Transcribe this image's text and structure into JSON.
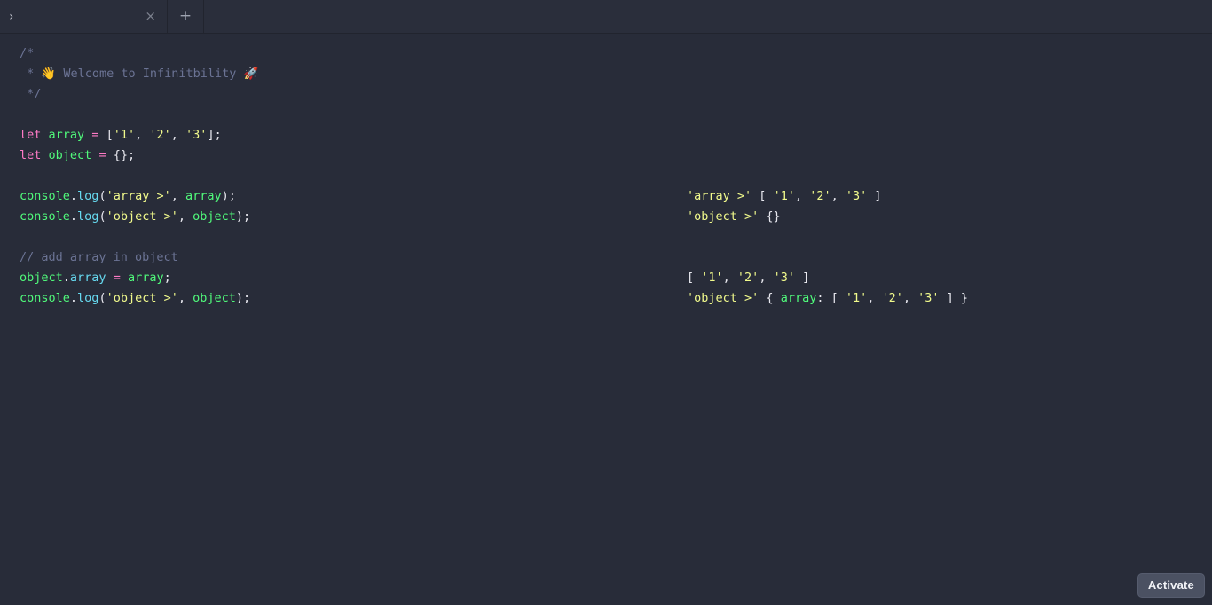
{
  "window": {
    "background_color": "#282c39",
    "chrome_color": "#2a2e3b"
  },
  "tabbar": {
    "tab": {
      "chevron_icon": "›",
      "title": "",
      "close_icon": "×"
    },
    "new_tab_icon": "+"
  },
  "editor": {
    "language": "javascript",
    "lines": [
      [
        {
          "t": "comment",
          "s": "/*"
        }
      ],
      [
        {
          "t": "comment",
          "s": " * "
        },
        {
          "t": "emoji",
          "s": "👋"
        },
        {
          "t": "comment",
          "s": " Welcome to Infinitbility "
        },
        {
          "t": "emoji",
          "s": "🚀"
        }
      ],
      [
        {
          "t": "comment",
          "s": " */"
        }
      ],
      [
        {
          "t": "plain",
          "s": ""
        }
      ],
      [
        {
          "t": "keyword",
          "s": "let"
        },
        {
          "t": "plain",
          "s": " "
        },
        {
          "t": "var",
          "s": "array"
        },
        {
          "t": "plain",
          "s": " "
        },
        {
          "t": "op",
          "s": "="
        },
        {
          "t": "plain",
          "s": " "
        },
        {
          "t": "punct",
          "s": "["
        },
        {
          "t": "string",
          "s": "'1'"
        },
        {
          "t": "punct",
          "s": ", "
        },
        {
          "t": "string",
          "s": "'2'"
        },
        {
          "t": "punct",
          "s": ", "
        },
        {
          "t": "string",
          "s": "'3'"
        },
        {
          "t": "punct",
          "s": "];"
        }
      ],
      [
        {
          "t": "keyword",
          "s": "let"
        },
        {
          "t": "plain",
          "s": " "
        },
        {
          "t": "var",
          "s": "object"
        },
        {
          "t": "plain",
          "s": " "
        },
        {
          "t": "op",
          "s": "="
        },
        {
          "t": "plain",
          "s": " "
        },
        {
          "t": "punct",
          "s": "{};"
        }
      ],
      [
        {
          "t": "plain",
          "s": ""
        }
      ],
      [
        {
          "t": "var",
          "s": "console"
        },
        {
          "t": "punct",
          "s": "."
        },
        {
          "t": "prop",
          "s": "log"
        },
        {
          "t": "punct",
          "s": "("
        },
        {
          "t": "string",
          "s": "'array >'"
        },
        {
          "t": "punct",
          "s": ", "
        },
        {
          "t": "var",
          "s": "array"
        },
        {
          "t": "punct",
          "s": ");"
        }
      ],
      [
        {
          "t": "var",
          "s": "console"
        },
        {
          "t": "punct",
          "s": "."
        },
        {
          "t": "prop",
          "s": "log"
        },
        {
          "t": "punct",
          "s": "("
        },
        {
          "t": "string",
          "s": "'object >'"
        },
        {
          "t": "punct",
          "s": ", "
        },
        {
          "t": "var",
          "s": "object"
        },
        {
          "t": "punct",
          "s": ");"
        }
      ],
      [
        {
          "t": "plain",
          "s": ""
        }
      ],
      [
        {
          "t": "comment",
          "s": "// add array in object"
        }
      ],
      [
        {
          "t": "var",
          "s": "object"
        },
        {
          "t": "punct",
          "s": "."
        },
        {
          "t": "prop",
          "s": "array"
        },
        {
          "t": "plain",
          "s": " "
        },
        {
          "t": "op",
          "s": "="
        },
        {
          "t": "plain",
          "s": " "
        },
        {
          "t": "var",
          "s": "array"
        },
        {
          "t": "punct",
          "s": ";"
        }
      ],
      [
        {
          "t": "var",
          "s": "console"
        },
        {
          "t": "punct",
          "s": "."
        },
        {
          "t": "prop",
          "s": "log"
        },
        {
          "t": "punct",
          "s": "("
        },
        {
          "t": "string",
          "s": "'object >'"
        },
        {
          "t": "punct",
          "s": ", "
        },
        {
          "t": "var",
          "s": "object"
        },
        {
          "t": "punct",
          "s": ");"
        }
      ]
    ]
  },
  "console": {
    "lines": [
      [
        {
          "t": "plain",
          "s": ""
        }
      ],
      [
        {
          "t": "plain",
          "s": ""
        }
      ],
      [
        {
          "t": "plain",
          "s": ""
        }
      ],
      [
        {
          "t": "plain",
          "s": ""
        }
      ],
      [
        {
          "t": "plain",
          "s": ""
        }
      ],
      [
        {
          "t": "plain",
          "s": ""
        }
      ],
      [
        {
          "t": "plain",
          "s": ""
        }
      ],
      [
        {
          "t": "string",
          "s": "'array >'"
        },
        {
          "t": "plain",
          "s": " "
        },
        {
          "t": "punct",
          "s": "[ "
        },
        {
          "t": "string",
          "s": "'1'"
        },
        {
          "t": "punct",
          "s": ", "
        },
        {
          "t": "string",
          "s": "'2'"
        },
        {
          "t": "punct",
          "s": ", "
        },
        {
          "t": "string",
          "s": "'3'"
        },
        {
          "t": "punct",
          "s": " ]"
        }
      ],
      [
        {
          "t": "string",
          "s": "'object >'"
        },
        {
          "t": "plain",
          "s": " "
        },
        {
          "t": "punct",
          "s": "{}"
        }
      ],
      [
        {
          "t": "plain",
          "s": ""
        }
      ],
      [
        {
          "t": "plain",
          "s": ""
        }
      ],
      [
        {
          "t": "punct",
          "s": "[ "
        },
        {
          "t": "string",
          "s": "'1'"
        },
        {
          "t": "punct",
          "s": ", "
        },
        {
          "t": "string",
          "s": "'2'"
        },
        {
          "t": "punct",
          "s": ", "
        },
        {
          "t": "string",
          "s": "'3'"
        },
        {
          "t": "punct",
          "s": " ]"
        }
      ],
      [
        {
          "t": "string",
          "s": "'object >'"
        },
        {
          "t": "plain",
          "s": " "
        },
        {
          "t": "punct",
          "s": "{ "
        },
        {
          "t": "key",
          "s": "array"
        },
        {
          "t": "punct",
          "s": ": [ "
        },
        {
          "t": "string",
          "s": "'1'"
        },
        {
          "t": "punct",
          "s": ", "
        },
        {
          "t": "string",
          "s": "'2'"
        },
        {
          "t": "punct",
          "s": ", "
        },
        {
          "t": "string",
          "s": "'3'"
        },
        {
          "t": "punct",
          "s": " ] }"
        }
      ]
    ]
  },
  "overlay": {
    "activate_label": "Activate"
  }
}
